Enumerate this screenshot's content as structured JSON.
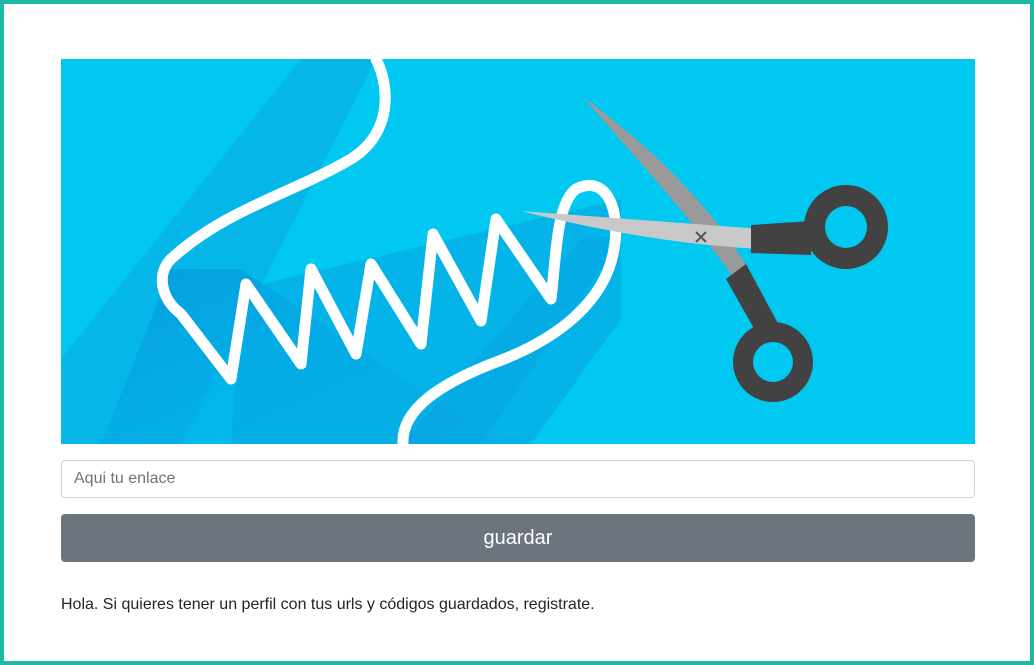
{
  "form": {
    "link_placeholder": "Aqui tu enlace",
    "link_value": "",
    "save_label": "guardar"
  },
  "footer": {
    "message": "Hola. Si quieres tener un perfil con tus urls y códigos guardados, registrate."
  },
  "hero": {
    "illustration": "scissors-cutting-cord-illustration"
  },
  "colors": {
    "frame_border": "#1fb8a6",
    "hero_background": "#00c8f0",
    "button_background": "#6c757d",
    "button_text": "#ffffff",
    "text": "#212529"
  }
}
